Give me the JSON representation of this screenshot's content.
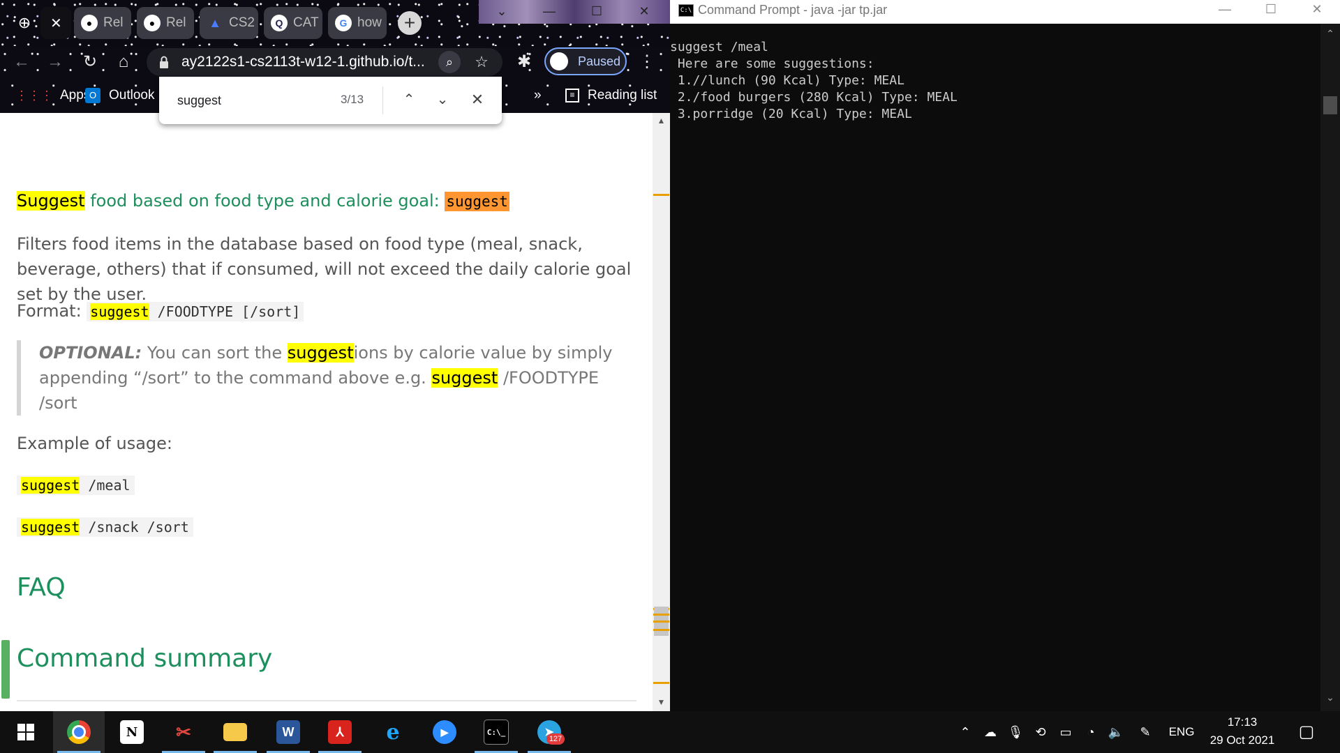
{
  "browser": {
    "tabs": [
      {
        "label": "Rel",
        "icon": "github-icon"
      },
      {
        "label": "Rel",
        "icon": "github-icon"
      },
      {
        "label": "CS2",
        "icon": "graduation-cap-icon"
      },
      {
        "label": "CAT",
        "icon": "search-app-icon"
      },
      {
        "label": "how",
        "icon": "google-icon"
      }
    ],
    "address": "ay2122s1-cs2113t-w12-1.github.io/t...",
    "profile_status": "Paused",
    "bookmarks": {
      "apps": "Apps",
      "outlook": "Outlook",
      "overflow": "»",
      "reading_list": "Reading list"
    },
    "find": {
      "query": "suggest",
      "count": "3/13"
    }
  },
  "page": {
    "heading_hl": "Suggest",
    "heading_rest": " food based on food type and calorie goal: ",
    "heading_code": "suggest",
    "description": "Filters food items in the database based on food type (meal, snack, beverage, others) that if consumed, will not exceed the daily calorie goal set by the user.",
    "format_label": "Format: ",
    "format_cmd": "suggest",
    "format_args": " /FOODTYPE [/sort]",
    "optional_label": "OPTIONAL:",
    "optional_t1": " You can sort the ",
    "optional_hl1": "suggest",
    "optional_t2": "ions by calorie value by simply appending “/sort” to the command above e.g. ",
    "optional_hl2": "suggest",
    "optional_t3": " /FOODTYPE /sort",
    "example_label": "Example of usage:",
    "ex1_cmd": "suggest",
    "ex1_args": " /meal",
    "ex2_cmd": "suggest",
    "ex2_args": " /snack /sort",
    "faq_heading": "FAQ",
    "summary_heading": "Command summary"
  },
  "cmd": {
    "title": "Command Prompt - java  -jar tp.jar",
    "output": "suggest /meal\n Here are some suggestions:\n 1.//lunch (90 Kcal) Type: MEAL\n 2./food burgers (280 Kcal) Type: MEAL\n 3.porridge (20 Kcal) Type: MEAL"
  },
  "taskbar": {
    "apps": [
      "windows-start",
      "chrome",
      "notion",
      "snipping-tool",
      "file-explorer",
      "word",
      "acrobat",
      "internet-explorer",
      "zoom",
      "command-prompt",
      "telegram"
    ],
    "telegram_badge": "127",
    "language": "ENG",
    "time": "17:13",
    "date": "29 Oct 2021"
  },
  "colors": {
    "highlight": "#ffff00",
    "current_highlight": "#ff9632",
    "heading_green": "#1d8f5c"
  }
}
